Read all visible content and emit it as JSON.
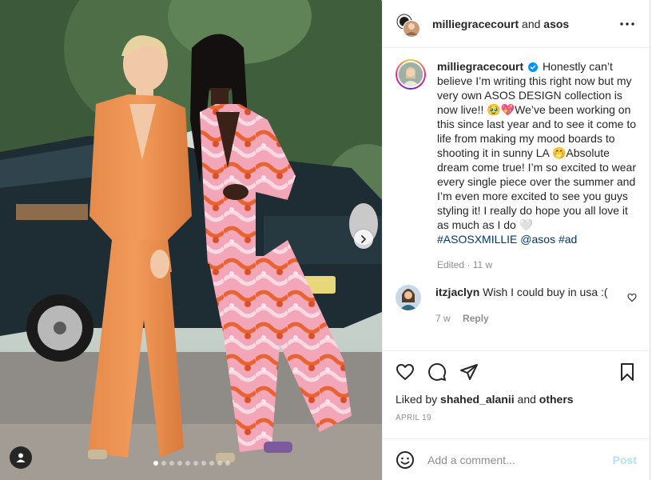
{
  "header": {
    "username": "milliegracecourt",
    "joiner": "and",
    "collaborator": "asos"
  },
  "caption": {
    "username": "milliegracecourt",
    "text": "Honestly can’t believe I’m writing this right now but my very own ASOS DESIGN collection is now live!! 🥹💖We’ve been working on this since last year and to see it come to life from making my mood boards to shooting it in sunny LA 🤭Absolute dream come true! I’m so excited to wear every single piece over the summer and I’m even more excited to see you guys styling it! I really do hope you all love it as much as I do 🤍",
    "tags": [
      "#ASOSXMILLIE",
      "@asos",
      "#ad"
    ],
    "meta": "Edited · 11 w"
  },
  "comment": {
    "username": "itzjaclyn",
    "text": "Wish I could buy in usa :(",
    "age": "7 w",
    "reply_label": "Reply"
  },
  "likes": {
    "prefix": "Liked by",
    "user": "shahed_alanii",
    "joiner": "and",
    "others": "others"
  },
  "date": "APRIL 19",
  "composer": {
    "placeholder": "Add a comment...",
    "post_label": "Post"
  },
  "carousel": {
    "total": 10,
    "active_index": 0
  },
  "icons": {
    "header_more": "more-horizontal-icon",
    "verified": "verified-badge-icon",
    "like": "heart-icon",
    "comment": "comment-bubble-icon",
    "share": "paper-plane-icon",
    "save": "bookmark-icon",
    "emoji": "emoji-icon",
    "next": "chevron-right-icon",
    "tags": "user-tag-icon"
  },
  "colors": {
    "link": "#00376b",
    "secondary_text": "#8e8e8e",
    "post_disabled": "#b2dffc",
    "verified": "#0095f6"
  }
}
